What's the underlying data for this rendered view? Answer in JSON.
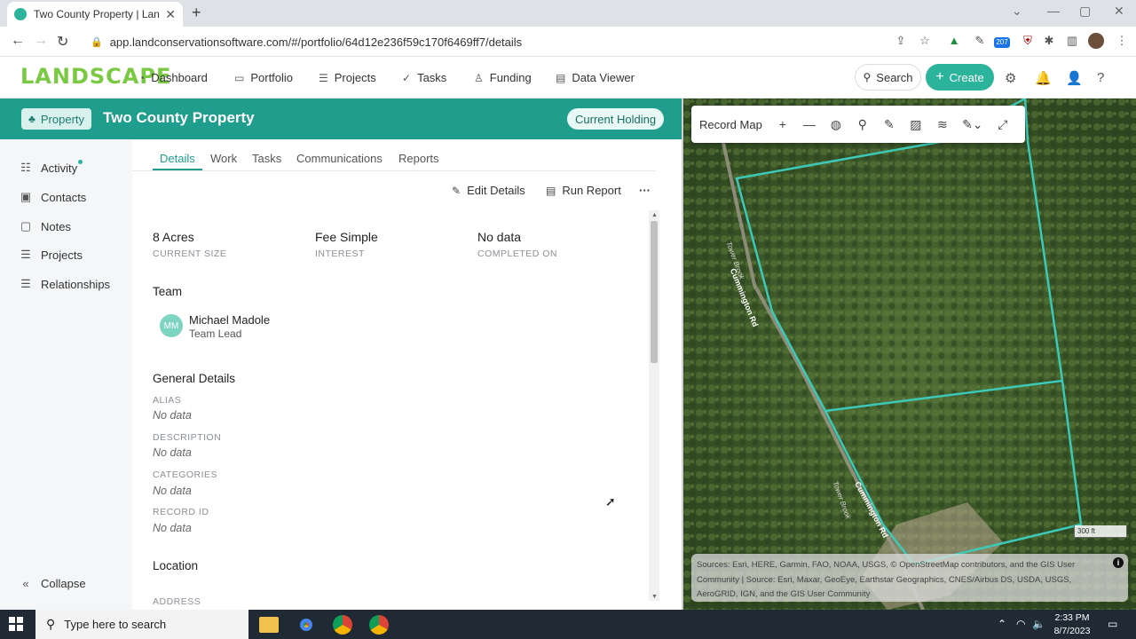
{
  "browser": {
    "tab_title": "Two County Property | Landscape",
    "url": "app.landconservationsoftware.com/#/portfolio/64d12e236f59c170f6469ff7/details",
    "extension_badge": "207"
  },
  "header": {
    "logo": "LANDSCAPE",
    "nav": [
      "Dashboard",
      "Portfolio",
      "Projects",
      "Tasks",
      "Funding",
      "Data Viewer"
    ],
    "search_label": "Search",
    "create_label": "Create"
  },
  "banner": {
    "type_label": "Property",
    "name": "Two County Property",
    "status": "Current Holding"
  },
  "sidebar": {
    "items": [
      "Activity",
      "Contacts",
      "Notes",
      "Projects",
      "Relationships"
    ],
    "collapse_label": "Collapse"
  },
  "tabs": [
    "Details",
    "Work",
    "Tasks",
    "Communications",
    "Reports"
  ],
  "actions": {
    "edit": "Edit Details",
    "run": "Run Report",
    "more": "···"
  },
  "summary": [
    {
      "value": "8 Acres",
      "label": "CURRENT SIZE"
    },
    {
      "value": "Fee Simple",
      "label": "INTEREST"
    },
    {
      "value": "No data",
      "label": "COMPLETED ON"
    }
  ],
  "team": {
    "heading": "Team",
    "initials": "MM",
    "name": "Michael Madole",
    "role": "Team Lead"
  },
  "general": {
    "heading": "General Details",
    "fields": [
      {
        "label": "ALIAS",
        "value": "No data"
      },
      {
        "label": "DESCRIPTION",
        "value": "No data"
      },
      {
        "label": "CATEGORIES",
        "value": "No data"
      },
      {
        "label": "RECORD ID",
        "value": "No data"
      }
    ]
  },
  "location": {
    "heading": "Location",
    "address_label": "ADDRESS"
  },
  "map": {
    "title": "Record Map",
    "road_label": "Cummington Rd",
    "brook_label": "Tower Brook",
    "scale": "300 ft",
    "attribution": "Sources: Esri, HERE, Garmin, FAO, NOAA, USGS, © OpenStreetMap contributors, and the GIS User Community | Source: Esri, Maxar, GeoEye, Earthstar Geographics, CNES/Airbus DS, USDA, USGS, AeroGRID, IGN, and the GIS User Community"
  },
  "taskbar": {
    "search_placeholder": "Type here to search",
    "time": "2:33 PM",
    "date": "8/7/2023"
  }
}
